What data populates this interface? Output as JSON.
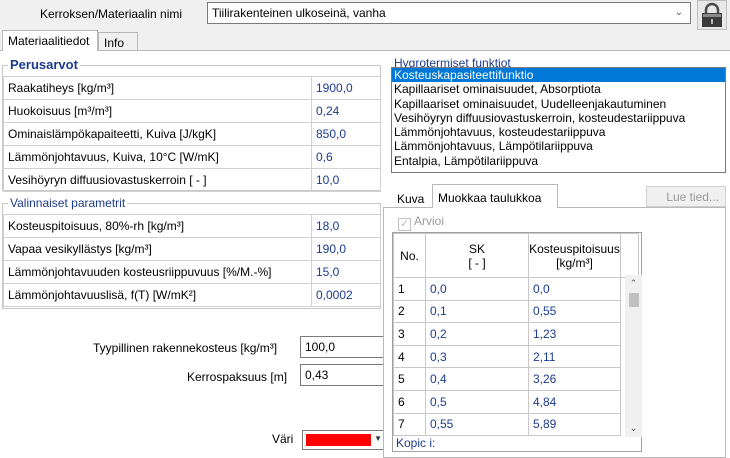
{
  "layer": {
    "label": "Kerroksen/Materiaalin nimi",
    "value": "Tiilirakenteinen ulkoseinä, vanha"
  },
  "tabs": {
    "material": "Materiaalitiedot",
    "info": "Info"
  },
  "basic": {
    "title": "Perusarvot",
    "rows": [
      {
        "label": "Raakatiheys [kg/m³]",
        "value": "1900,0"
      },
      {
        "label": "Huokoisuus [m³/m³]",
        "value": "0,24"
      },
      {
        "label": "Ominaislämpökapaiteetti, Kuiva [J/kgK]",
        "value": "850,0"
      },
      {
        "label": "Lämmönjohtavuus, Kuiva, 10°C [W/mK]",
        "value": "0,6"
      },
      {
        "label": "Vesihöyryn diffuusiovastuskerroin [ - ]",
        "value": "10,0"
      }
    ]
  },
  "optional": {
    "title": "Valinnaiset parametrit",
    "rows": [
      {
        "label": "Kosteuspitoisuus, 80%-rh [kg/m³]",
        "value": "18,0"
      },
      {
        "label": "Vapaa vesikyllästys [kg/m³]",
        "value": "190,0"
      },
      {
        "label": "Lämmönjohtavuuden kosteusriippuvuus [%/M.-%]",
        "value": "15,0"
      },
      {
        "label": "Lämmönjohtavuuslisä, f(T) [W/mK²]",
        "value": "0,0002"
      }
    ]
  },
  "fields": {
    "moisture_label": "Tyypillinen rakennekosteus [kg/m³]",
    "moisture_value": "100,0",
    "thickness_label": "Kerrospaksuus [m]",
    "thickness_value": "0,43",
    "color_label": "Väri",
    "color_value": "#ff0000"
  },
  "hygro": {
    "title": "Hygrotermiset funktiot",
    "items": [
      "Kosteuskapasiteettifunktio",
      "Kapillaariset ominaisuudet, Absorptiota",
      "Kapillaariset ominaisuudet, Uudelleenjakautuminen",
      "Vesihöyryn diffuusiovastuskerroin, kosteudestariippuva",
      "Lämmönjohtavuus, kosteudestariippuva",
      "Lämmönjohtavuus, Lämpötilariippuva",
      "Entalpia, Lämpötilariippuva"
    ],
    "selected_index": 0
  },
  "subtabs": {
    "image": "Kuva",
    "edit_table": "Muokkaa taulukkoa"
  },
  "read_button": "Lue tied...",
  "estimate_label": "Arvioi",
  "grid": {
    "headers": {
      "no": "No.",
      "sk": "SK",
      "sk_unit": "[ - ]",
      "kp": "Kosteuspitoisuus",
      "kp_unit": "[kg/m³]"
    },
    "rows": [
      {
        "no": "1",
        "sk": "0,0",
        "kp": "0,0"
      },
      {
        "no": "2",
        "sk": "0,1",
        "kp": "0,55"
      },
      {
        "no": "3",
        "sk": "0,2",
        "kp": "1,23"
      },
      {
        "no": "4",
        "sk": "0,3",
        "kp": "2,11"
      },
      {
        "no": "5",
        "sk": "0,4",
        "kp": "3,26"
      },
      {
        "no": "6",
        "sk": "0,5",
        "kp": "4,84"
      },
      {
        "no": "7",
        "sk": "0,55",
        "kp": "5,89"
      }
    ]
  },
  "copy_label": "Kopic i:"
}
